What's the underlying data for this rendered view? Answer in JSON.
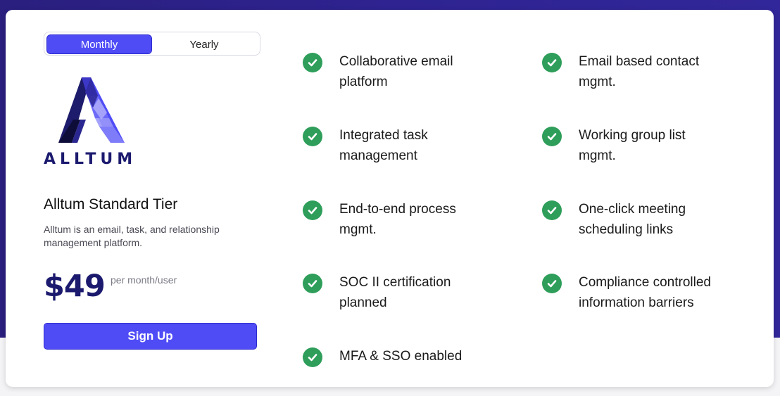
{
  "billing_toggle": {
    "monthly_label": "Monthly",
    "yearly_label": "Yearly",
    "selected": "Monthly"
  },
  "brand": {
    "name": "ALLTUM"
  },
  "plan": {
    "title": "Alltum Standard Tier",
    "description": "Alltum is an email, task, and relationship management platform.",
    "price": "$49",
    "price_unit": "per month/user",
    "cta_label": "Sign Up"
  },
  "features": [
    "Collaborative email platform",
    "Email based contact mgmt.",
    "Integrated task management",
    "Working group list mgmt.",
    "End-to-end process mgmt.",
    "One-click meeting scheduling links",
    "SOC II certification planned",
    "Compliance controlled information barriers",
    "MFA & SSO enabled"
  ],
  "colors": {
    "accent": "#4f4cf6",
    "brand_navy": "#1b1a6e",
    "check_green": "#2e9e5a",
    "header_purple": "#2e2390"
  },
  "icons": {
    "feature_check": "check-circle-icon",
    "logo": "alltum-logo-icon"
  }
}
